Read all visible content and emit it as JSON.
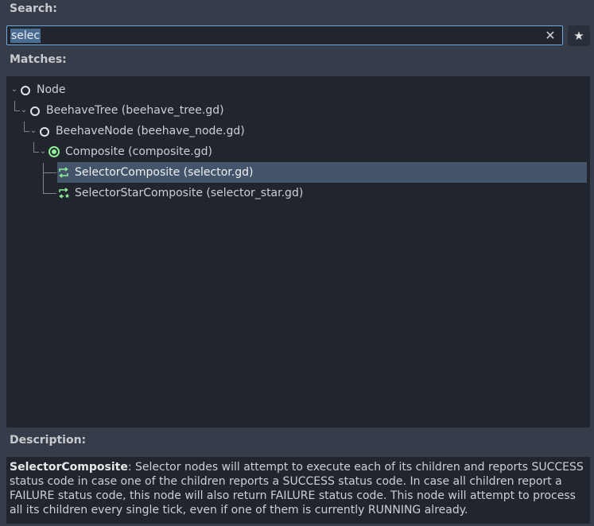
{
  "labels": {
    "search": "Search:",
    "matches": "Matches:",
    "description": "Description:"
  },
  "search": {
    "value": "selec",
    "clear_icon": "close-icon",
    "favorite_icon": "star-icon"
  },
  "tree": {
    "items": [
      {
        "label": "Node",
        "icon": "node-ring-icon",
        "expanded": true
      },
      {
        "label": "BeehaveTree (beehave_tree.gd)",
        "icon": "node-ring-icon",
        "expanded": true
      },
      {
        "label": "BeehaveNode (beehave_node.gd)",
        "icon": "node-ring-icon",
        "expanded": true
      },
      {
        "label": "Composite (composite.gd)",
        "icon": "composite-green-icon",
        "expanded": true
      },
      {
        "label": "SelectorComposite (selector.gd)",
        "icon": "selector-loop-icon",
        "selected": true
      },
      {
        "label": "SelectorStarComposite (selector_star.gd)",
        "icon": "selector-star-loop-icon"
      }
    ]
  },
  "description": {
    "title": "SelectorComposite",
    "text": ": Selector nodes will attempt to execute each of its children and reports SUCCESS status code in case one of the children reports a SUCCESS status code. In case all children report a FAILURE status code, this node will also return FAILURE status code. This node will attempt to process all its children every single tick, even if one of them is currently RUNNING already."
  },
  "colors": {
    "background": "#363d4a",
    "panel": "#21262e",
    "selection": "#44556b",
    "accent": "#6fa8dc",
    "composite_green": "#8eef97"
  }
}
